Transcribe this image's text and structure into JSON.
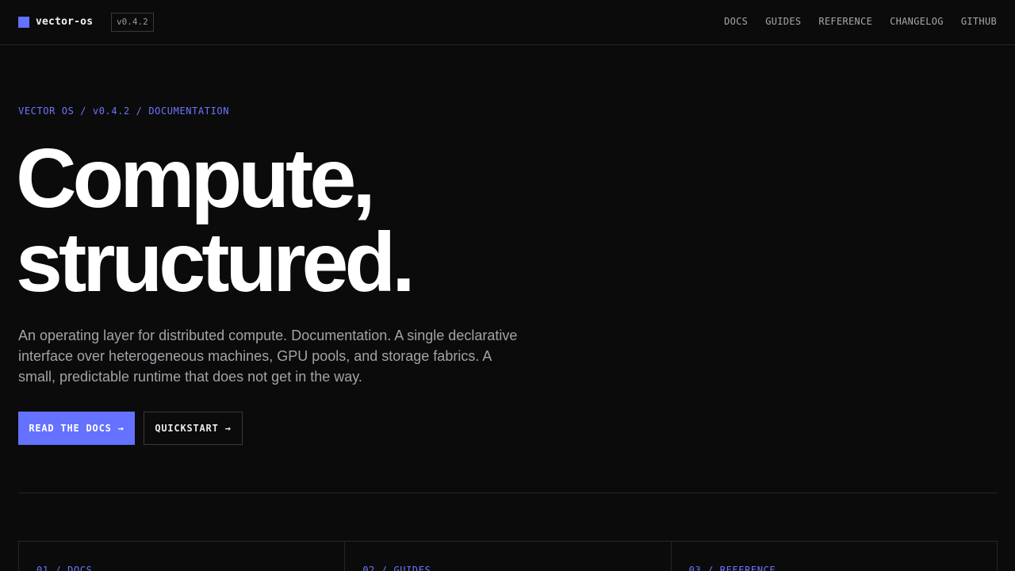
{
  "brand": {
    "name": "vector-os",
    "version": "v0.4.2",
    "accent": "#6571ff",
    "icon": "square-logo-icon"
  },
  "nav": [
    "DOCS",
    "GUIDES",
    "REFERENCE",
    "CHANGELOG",
    "GITHUB"
  ],
  "hero": {
    "crumb": "VECTOR OS / v0.4.2 / DOCUMENTATION",
    "headline_line1": "Compute,",
    "headline_line2": "structured.",
    "lead": "An operating layer for distributed compute. Documentation. A single declarative interface over heterogeneous machines, GPU pools, and storage fabrics. A small, predictable runtime that does not get in the way.",
    "primary_cta": "READ THE DOCS →",
    "secondary_cta": "QUICKSTART →"
  },
  "cards": [
    "01 / DOCS",
    "02 / GUIDES",
    "03 / REFERENCE"
  ]
}
